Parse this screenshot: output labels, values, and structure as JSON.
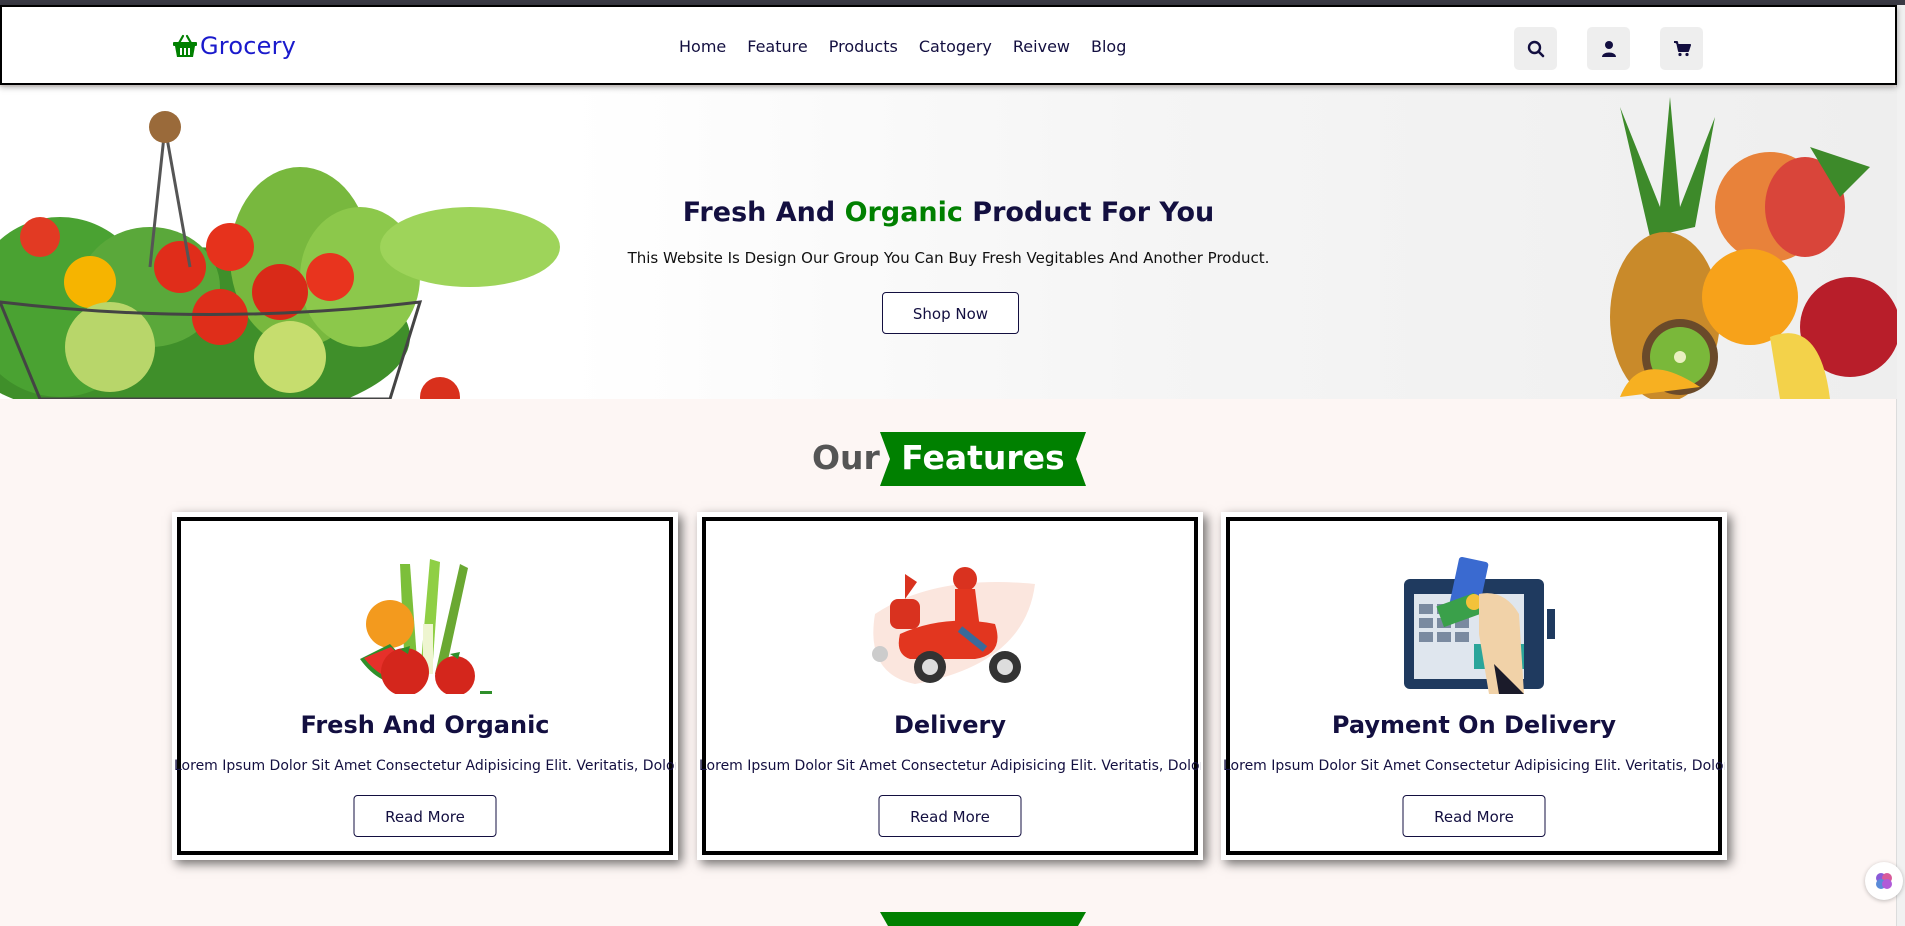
{
  "header": {
    "logo_text": "Grocery",
    "nav": [
      "Home",
      "Feature",
      "Products",
      "Catogery",
      "Reivew",
      "Blog"
    ],
    "icons": [
      "search-icon",
      "user-icon",
      "cart-icon"
    ]
  },
  "hero": {
    "title_part1": "Fresh And ",
    "title_highlight": "Organic",
    "title_part2": " Product For You",
    "description": "This Website Is Design Our Group You Can Buy Fresh Vegitables And Another Product.",
    "button": "Shop Now"
  },
  "features": {
    "heading_plain": "Our",
    "heading_highlight": "Features",
    "cards": [
      {
        "title": "Fresh And Organic",
        "text": "Lorem Ipsum Dolor Sit Amet Consectetur Adipisicing Elit. Veritatis, Dolore.",
        "button": "Read More",
        "image": "fresh-produce-illustration"
      },
      {
        "title": "Delivery",
        "text": "Lorem Ipsum Dolor Sit Amet Consectetur Adipisicing Elit. Veritatis, Dolore.",
        "button": "Read More",
        "image": "delivery-scooter-illustration"
      },
      {
        "title": "Payment On Delivery",
        "text": "Lorem Ipsum Dolor Sit Amet Consectetur Adipisicing Elit. Veritatis, Dolore.",
        "button": "Read More",
        "image": "card-payment-illustration"
      }
    ]
  },
  "colors": {
    "brand_green": "#008000",
    "text_dark": "#130f40",
    "logo_blue": "#1a1acc"
  }
}
